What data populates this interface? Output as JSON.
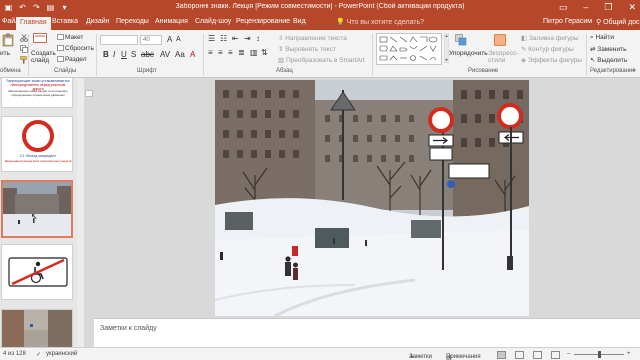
{
  "window": {
    "title": "Заборонні знаки. Лекція [Режим совместимости] - PowerPoint (Сбой активации продукта)"
  },
  "qat": {
    "icons": [
      "save-icon",
      "undo-icon",
      "redo-icon",
      "start-from-beginning-icon",
      "customize-qat-icon"
    ]
  },
  "window_controls": {
    "minimize": "–",
    "restore": "❐",
    "close": "✕"
  },
  "tabs": [
    {
      "label": "Файл"
    },
    {
      "label": "Главная",
      "active": true
    },
    {
      "label": "Вставка"
    },
    {
      "label": "Дизайн"
    },
    {
      "label": "Переходы"
    },
    {
      "label": "Анимация"
    },
    {
      "label": "Слайд-шоу"
    },
    {
      "label": "Рецензирование"
    },
    {
      "label": "Вид"
    }
  ],
  "tell_me": "Что вы хотите сделать?",
  "user_name": "Питро Герасим",
  "share_label": "Общий дос",
  "ribbon": {
    "clipboard": {
      "paste": "ить",
      "group": "обмена"
    },
    "slides": {
      "new_slide": "Создать слайд",
      "layout": "Макет",
      "reset": "Сбросить",
      "section": "Раздел",
      "group": "Слайды"
    },
    "font": {
      "size_value": "40",
      "group": "Шрифт"
    },
    "paragraph": {
      "text_direction": "Направление текста",
      "align_text": "Выровнять текст",
      "convert_smartart": "Преобразовать в SmartArt",
      "group": "Абзац"
    },
    "drawing": {
      "arrange": "Упорядочить",
      "quick_styles": "Экспресс-стили",
      "fill": "Заливка фигуры",
      "outline": "Контур фигуры",
      "effects": "Эффекты фигуры",
      "group": "Рисование"
    },
    "editing": {
      "find": "Найти",
      "replace": "Заменить",
      "select": "Выделить",
      "group": "Редактирование"
    }
  },
  "thumbnails": [
    {
      "number": "",
      "lines": [
        "Запрещающие знаки вводят или отменяют",
        "определённые ограничения движения",
        "Запрещающие знаки устанавливаются",
        "непосредственно перед участком дороги"
      ]
    },
    {
      "number": "",
      "lines": [
        "3.1 «Въезд запрещён»",
        "Запрещается въезд всех транспортных средств"
      ]
    },
    {
      "number": "",
      "lines": []
    },
    {
      "number": "",
      "lines": []
    },
    {
      "number": "",
      "lines": []
    }
  ],
  "slide_photo": {
    "signs": [
      {
        "kind": "no-entry-sign"
      },
      {
        "kind": "no-entry-sign"
      },
      {
        "kind": "direction-arrow-sign"
      },
      {
        "kind": "direction-arrow-sign"
      },
      {
        "kind": "text-plate-sign"
      }
    ]
  },
  "notes": {
    "placeholder": "Заметки к слайду"
  },
  "status": {
    "slide_of": "4 из 128",
    "language": "украинский",
    "notes_label": "Заметки",
    "comments_label": "Примечания"
  },
  "colors": {
    "accent": "#b7472a",
    "ribbon_bg": "#f3f3f3",
    "canvas_bg": "#d9d9d9",
    "thumb_selected": "#e07a5f"
  }
}
